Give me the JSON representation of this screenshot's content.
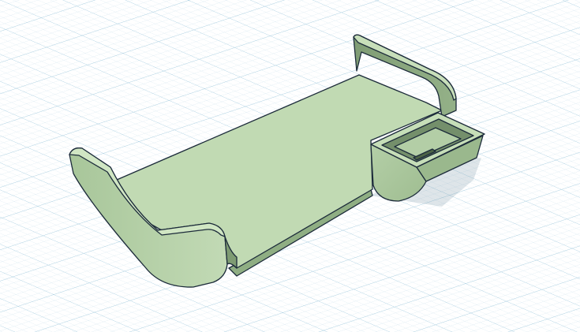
{
  "app": {
    "title": ""
  },
  "workplane": {
    "background": "#ffffff",
    "minor_line_color": "#cfe3ee",
    "major_line_color": "#9cc7dd"
  },
  "model": {
    "name": "",
    "fill_top": "#c3dcb6",
    "fill_side": "#a9c79a",
    "fill_shadow_side": "#8da982",
    "fill_dark": "#6f8a66",
    "edge_color": "#1c2b3a"
  }
}
